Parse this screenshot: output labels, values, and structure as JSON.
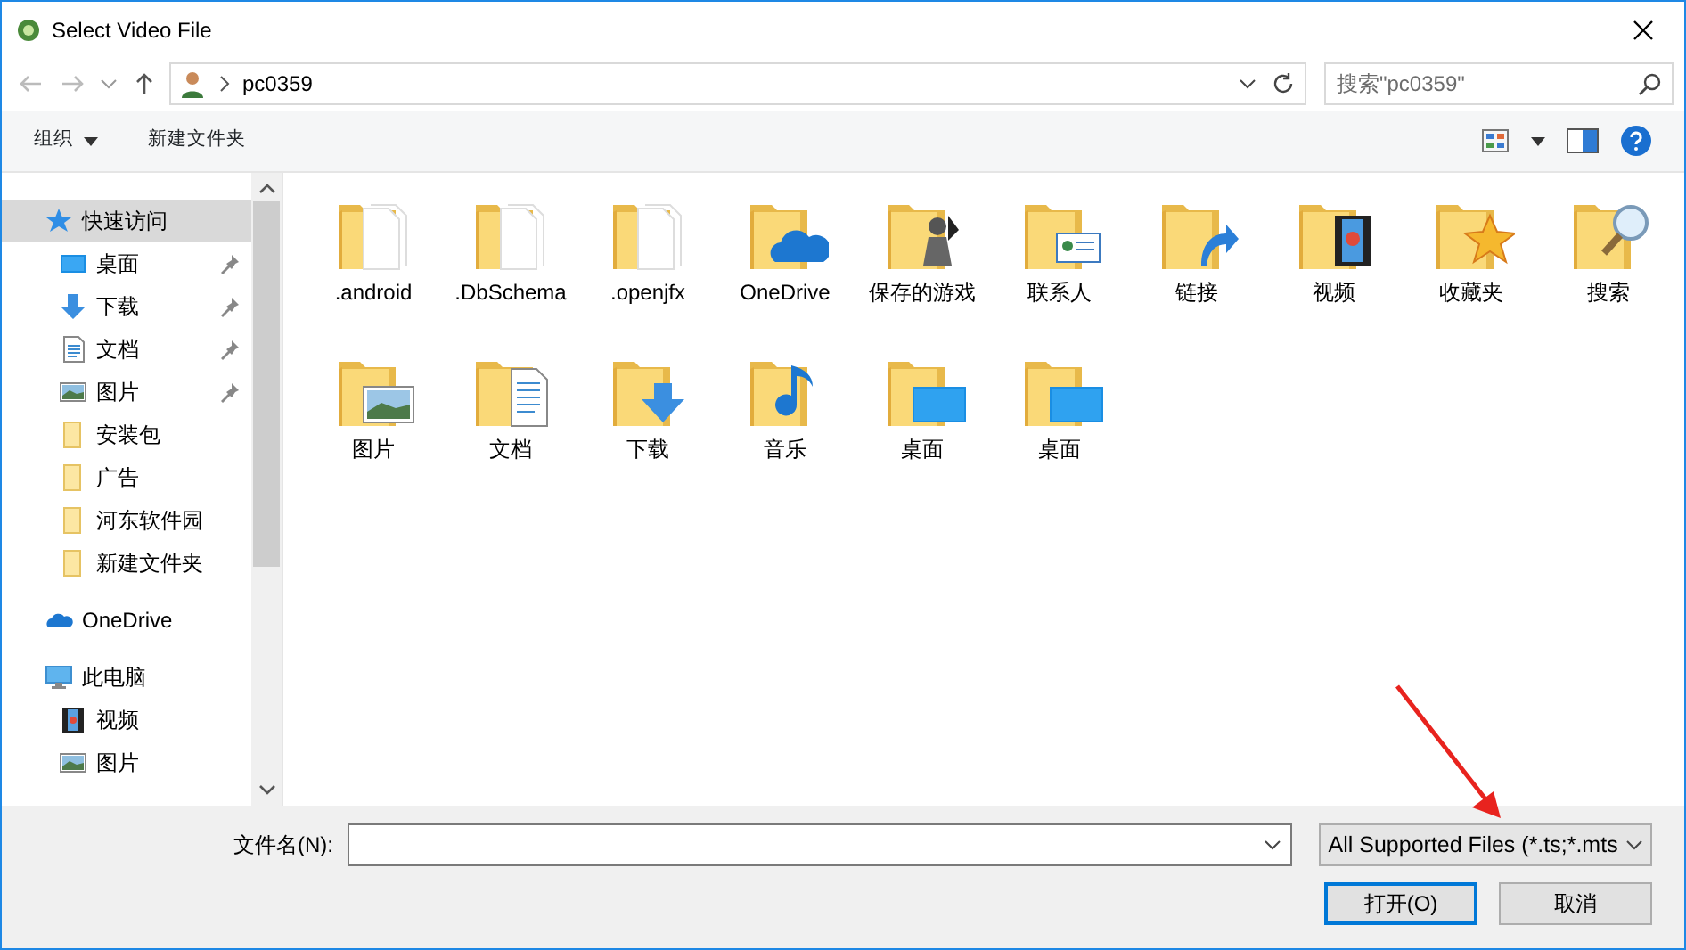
{
  "window": {
    "title": "Select Video File"
  },
  "address": {
    "path": "pc0359"
  },
  "search": {
    "placeholder": "搜索\"pc0359\""
  },
  "toolbar": {
    "organize": "组织",
    "new_folder": "新建文件夹"
  },
  "sidebar": {
    "items": [
      {
        "label": "快速访问",
        "kind": "star",
        "selected": true,
        "children": [
          {
            "label": "桌面",
            "kind": "desktop",
            "pinned": true,
            "selected": false
          },
          {
            "label": "下载",
            "kind": "download",
            "pinned": true,
            "selected": false
          },
          {
            "label": "文档",
            "kind": "document",
            "pinned": true,
            "selected": false
          },
          {
            "label": "图片",
            "kind": "picture",
            "pinned": true,
            "selected": false
          },
          {
            "label": "安装包",
            "kind": "folder",
            "pinned": false,
            "selected": false
          },
          {
            "label": "广告",
            "kind": "folder",
            "pinned": false,
            "selected": false
          },
          {
            "label": "河东软件园",
            "kind": "folder",
            "pinned": false,
            "selected": false
          },
          {
            "label": "新建文件夹",
            "kind": "folder",
            "pinned": false,
            "selected": false
          }
        ]
      },
      {
        "label": "OneDrive",
        "kind": "onedrive",
        "selected": false
      },
      {
        "label": "此电脑",
        "kind": "pc",
        "selected": false,
        "children": [
          {
            "label": "视频",
            "kind": "video",
            "pinned": false,
            "selected": false
          },
          {
            "label": "图片",
            "kind": "picture",
            "pinned": false,
            "selected": false
          }
        ]
      }
    ]
  },
  "files": [
    {
      "name": ".android",
      "kind": "plain"
    },
    {
      "name": ".DbSchema",
      "kind": "plain"
    },
    {
      "name": ".openjfx",
      "kind": "plain"
    },
    {
      "name": "OneDrive",
      "kind": "onedrive"
    },
    {
      "name": "保存的游戏",
      "kind": "games"
    },
    {
      "name": "联系人",
      "kind": "contacts"
    },
    {
      "name": "链接",
      "kind": "link"
    },
    {
      "name": "视频",
      "kind": "video"
    },
    {
      "name": "收藏夹",
      "kind": "favorites"
    },
    {
      "name": "搜索",
      "kind": "search"
    },
    {
      "name": "图片",
      "kind": "picture"
    },
    {
      "name": "文档",
      "kind": "document"
    },
    {
      "name": "下载",
      "kind": "download"
    },
    {
      "name": "音乐",
      "kind": "music"
    },
    {
      "name": "桌面",
      "kind": "desktop"
    },
    {
      "name": "桌面",
      "kind": "desktop"
    }
  ],
  "filename": {
    "label": "文件名(N):"
  },
  "file_type": {
    "value": "All Supported Files (*.ts;*.mts"
  },
  "buttons": [
    {
      "label": "打开(O)",
      "default": true
    },
    {
      "label": "取消",
      "default": false
    }
  ]
}
